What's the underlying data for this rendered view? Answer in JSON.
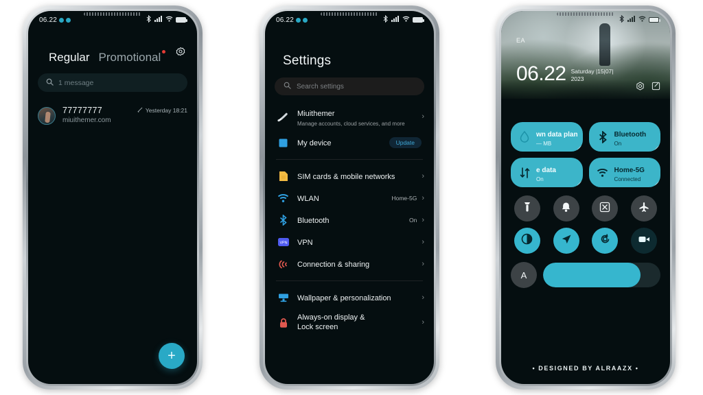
{
  "statusbar": {
    "time": "06.22",
    "icons": [
      "bluetooth-icon",
      "signal-icon",
      "wifi-icon",
      "battery-icon"
    ]
  },
  "phone1": {
    "name": "messages-app",
    "gear_icon": "gear-icon",
    "tabs": [
      {
        "label": "Regular",
        "active": true
      },
      {
        "label": "Promotional",
        "active": false,
        "has_dot": true
      }
    ],
    "search": {
      "icon": "search-icon",
      "placeholder": "1 message"
    },
    "messages": [
      {
        "sender": "77777777",
        "preview": "miuithemer.com",
        "time": "Yesterday 18:21",
        "status_icon": "sent-check-icon"
      }
    ],
    "fab": {
      "icon": "plus-icon",
      "label": "+"
    }
  },
  "phone2": {
    "name": "settings-app",
    "title": "Settings",
    "search": {
      "icon": "search-icon",
      "placeholder": "Search settings"
    },
    "account": {
      "label": "Miuithemer",
      "desc": "Manage accounts, cloud services, and more",
      "icon": "account-comet-icon"
    },
    "device": {
      "label": "My device",
      "icon": "device-square-icon",
      "badge": "Update"
    },
    "items": [
      {
        "label": "SIM cards & mobile networks",
        "value": "",
        "icon": "sim-card-icon"
      },
      {
        "label": "WLAN",
        "value": "Home-5G",
        "icon": "wifi-icon"
      },
      {
        "label": "Bluetooth",
        "value": "On",
        "icon": "bluetooth-icon"
      },
      {
        "label": "VPN",
        "value": "",
        "icon": "vpn-icon"
      },
      {
        "label": "Connection & sharing",
        "value": "",
        "icon": "connection-sharing-icon"
      }
    ],
    "items2": [
      {
        "label": "Wallpaper & personalization",
        "value": "",
        "icon": "wallpaper-icon"
      },
      {
        "label": "Always-on display & Lock screen",
        "value": "",
        "icon": "lock-icon"
      }
    ]
  },
  "phone3": {
    "name": "control-center",
    "carrier": "EA",
    "clock": "06.22",
    "date": "Saturday |15|07| 2023",
    "lock_actions": [
      "camera-icon",
      "note-edit-icon"
    ],
    "tiles": [
      {
        "title": "wn data plan",
        "sub": "— MB",
        "icon": "data-plan-icon",
        "on": true,
        "dim": true
      },
      {
        "title": "Bluetooth",
        "sub": "On",
        "icon": "bluetooth-icon",
        "on": true,
        "dim": false
      },
      {
        "title": "e data",
        "sub": "On",
        "icon": "mobile-data-icon",
        "on": true,
        "dim": true
      },
      {
        "title": "Home-5G",
        "sub": "Connected",
        "icon": "wifi-icon",
        "on": true,
        "dim": false
      }
    ],
    "circles": [
      {
        "icon": "flashlight-icon",
        "state": "off"
      },
      {
        "icon": "bell-icon",
        "state": "off"
      },
      {
        "icon": "screenshot-icon",
        "state": "off"
      },
      {
        "icon": "airplane-icon",
        "state": "off"
      },
      {
        "icon": "dark-mode-icon",
        "state": "on"
      },
      {
        "icon": "location-icon",
        "state": "on"
      },
      {
        "icon": "auto-rotate-icon",
        "state": "on"
      },
      {
        "icon": "screen-record-icon",
        "state": "dim"
      }
    ],
    "brightness": {
      "auto_label": "A",
      "level_percent": 83
    },
    "credit": "• DESIGNED BY ALRAAZX •"
  },
  "colors": {
    "accent": "#36b6ce",
    "tile": "#3cb5c9",
    "screen_bg": "#050e10",
    "page_bg": "#ffffff",
    "red_dot": "#e43b35"
  }
}
